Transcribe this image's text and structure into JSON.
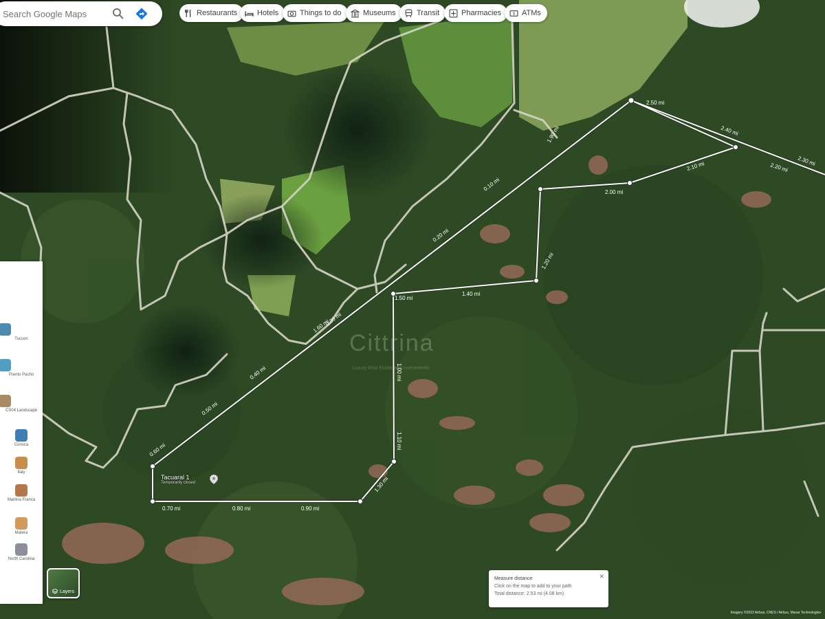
{
  "search": {
    "placeholder": "Search Google Maps"
  },
  "chips": [
    {
      "label": "Restaurants",
      "icon": "restaurant-icon"
    },
    {
      "label": "Hotels",
      "icon": "hotel-icon"
    },
    {
      "label": "Things to do",
      "icon": "camera-icon"
    },
    {
      "label": "Museums",
      "icon": "museum-icon"
    },
    {
      "label": "Transit",
      "icon": "transit-icon"
    },
    {
      "label": "Pharmacies",
      "icon": "pharmacy-icon"
    },
    {
      "label": "ATMs",
      "icon": "atm-icon"
    }
  ],
  "recent_places": [
    {
      "label": "Tucson"
    },
    {
      "label": "Puerto Pacho"
    },
    {
      "label": "CS04 Landscape"
    },
    {
      "label": "Corsica"
    },
    {
      "label": "Italy"
    },
    {
      "label": "Martina Franca"
    },
    {
      "label": "Matera"
    },
    {
      "label": "North Carolina"
    }
  ],
  "layers": {
    "label": "Layers"
  },
  "place": {
    "name": "Tacuaral 1",
    "status": "Temporarily closed"
  },
  "measure": {
    "title": "Measure distance",
    "hint": "Click on the map to add to your path",
    "total": "Total distance: 2.53 mi (4.08 km)"
  },
  "segment_labels": [
    "2.50 mi",
    "2.40 mi",
    "2.30 mi",
    "2.20 mi",
    "2.10 mi",
    "2.00 mi",
    "1.90 mi",
    "0.10 mi",
    "0.20 mi",
    "0.30 mi",
    "0.40 mi",
    "0.50 mi",
    "0.60 mi",
    "0.70 mi",
    "0.80 mi",
    "0.90 mi",
    "1.00 mi",
    "1.10 mi",
    "1.20 mi",
    "1.30 mi",
    "1.40 mi",
    "1.50 mi",
    "1.60 mi",
    "1.70 mi",
    "1.80 mi"
  ],
  "watermark": {
    "name": "Cittrina",
    "tagline": "Luxury Real Estate and Investments"
  },
  "attribution": "Imagery ©2023 Airbus, CNES / Airbus, Maxar Technologies",
  "colors": {
    "forest": "#2f4a25",
    "grass": "#6f9a48",
    "road": "#d7d4c8",
    "measure_line": "#ffffff"
  }
}
